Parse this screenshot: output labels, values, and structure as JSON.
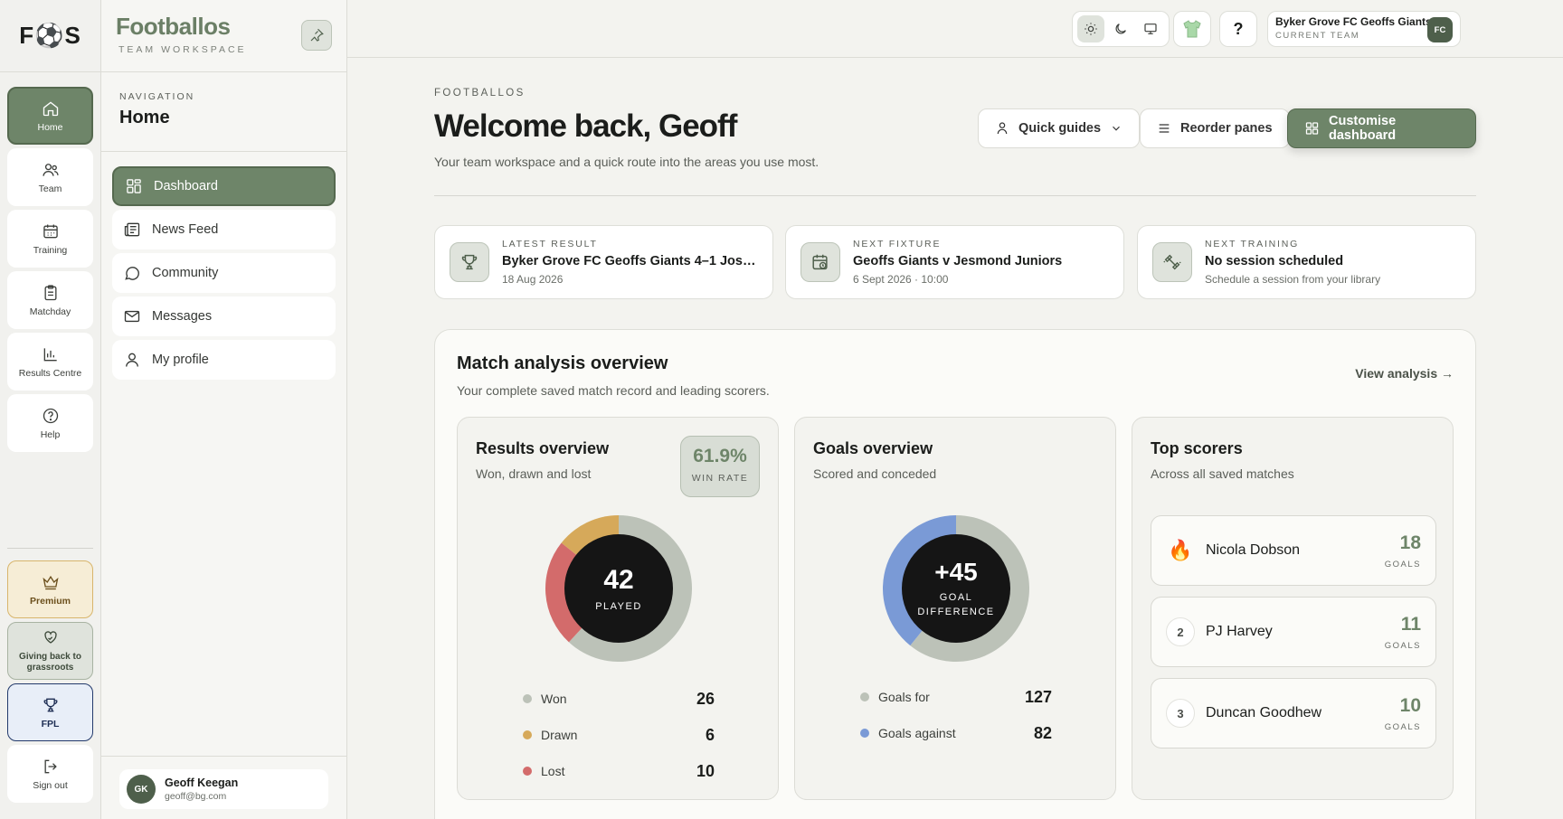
{
  "rail": {
    "logo": "F⚽S",
    "items": [
      {
        "label": "Home",
        "icon": "home-icon"
      },
      {
        "label": "Team",
        "icon": "users-icon"
      },
      {
        "label": "Training",
        "icon": "calendar-icon"
      },
      {
        "label": "Matchday",
        "icon": "clipboard-icon"
      },
      {
        "label": "Results Centre",
        "icon": "bar-chart-icon"
      },
      {
        "label": "Help",
        "icon": "help-circle-icon"
      }
    ],
    "bottom": [
      {
        "label": "Premium",
        "icon": "crown-icon"
      },
      {
        "label": "Giving back to grassroots",
        "icon": "heart-hands-icon"
      },
      {
        "label": "FPL",
        "icon": "trophy-icon"
      },
      {
        "label": "Sign out",
        "icon": "sign-out-icon"
      }
    ]
  },
  "panel": {
    "brand": "Footballos",
    "brand_sub": "TEAM WORKSPACE",
    "nav_kicker": "NAVIGATION",
    "nav_title": "Home",
    "items": [
      {
        "label": "Dashboard",
        "icon": "dashboard-icon"
      },
      {
        "label": "News Feed",
        "icon": "newspaper-icon"
      },
      {
        "label": "Community",
        "icon": "chat-bubble-icon"
      },
      {
        "label": "Messages",
        "icon": "mail-icon"
      },
      {
        "label": "My profile",
        "icon": "user-icon"
      }
    ],
    "user": {
      "initials": "GK",
      "name": "Geoff Keegan",
      "email": "geoff@bg.com"
    }
  },
  "topbar": {
    "help": "?",
    "team_name": "Byker Grove FC Geoffs Giants",
    "team_sub": "CURRENT TEAM",
    "team_badge": "FC"
  },
  "header": {
    "kicker": "FOOTBALLOS",
    "title": "Welcome back, Geoff",
    "subtitle": "Your team workspace and a quick route into the areas you use most.",
    "buttons": {
      "quick_guides": "Quick guides",
      "reorder": "Reorder panes",
      "customise": "Customise dashboard"
    }
  },
  "cards": [
    {
      "kicker": "LATEST RESULT",
      "title": "Byker Grove FC Geoffs Giants 4–1 Jossi…",
      "sub": "18 Aug 2026",
      "icon": "trophy-icon"
    },
    {
      "kicker": "NEXT FIXTURE",
      "title": "Geoffs Giants v Jesmond Juniors",
      "sub": "6 Sept 2026 · 10:00",
      "icon": "calendar-clock-icon"
    },
    {
      "kicker": "NEXT TRAINING",
      "title": "No session scheduled",
      "sub": "Schedule a session from your library",
      "icon": "dumbbell-icon"
    }
  ],
  "analysis": {
    "title": "Match analysis overview",
    "subtitle": "Your complete saved match record and leading scorers.",
    "link": "View analysis →",
    "results": {
      "title": "Results overview",
      "subtitle": "Won, drawn and lost",
      "win_rate": "61.9%",
      "win_rate_label": "WIN RATE",
      "center_value": "42",
      "center_label": "PLAYED",
      "legend": [
        {
          "label": "Won",
          "value": 26,
          "color": "#bcc2b8"
        },
        {
          "label": "Drawn",
          "value": 6,
          "color": "#d6a95a"
        },
        {
          "label": "Lost",
          "value": 10,
          "color": "#d36b6b"
        }
      ]
    },
    "goals": {
      "title": "Goals overview",
      "subtitle": "Scored and conceded",
      "center_value": "+45",
      "center_label_1": "GOAL",
      "center_label_2": "DIFFERENCE",
      "legend": [
        {
          "label": "Goals for",
          "value": 127,
          "color": "#bcc2b8"
        },
        {
          "label": "Goals against",
          "value": 82,
          "color": "#7a9ad6"
        }
      ]
    },
    "scorers": {
      "title": "Top scorers",
      "subtitle": "Across all saved matches",
      "goals_label": "GOALS",
      "list": [
        {
          "rank": "🔥",
          "name": "Nicola Dobson",
          "goals": 18
        },
        {
          "rank": "2",
          "name": "PJ Harvey",
          "goals": 11
        },
        {
          "rank": "3",
          "name": "Duncan Goodhew",
          "goals": 10
        }
      ]
    }
  }
}
